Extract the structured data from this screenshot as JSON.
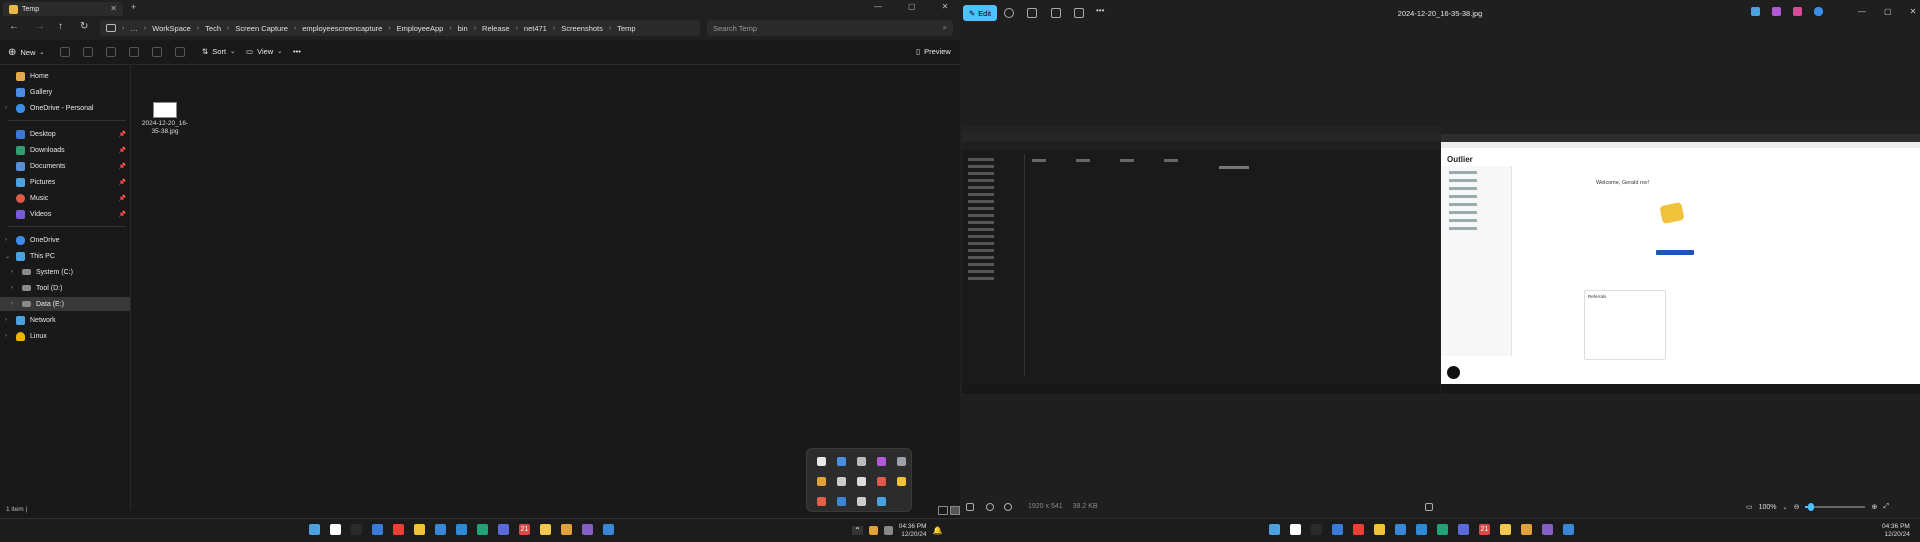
{
  "explorer": {
    "tab_title": "Temp",
    "breadcrumb": [
      "WorkSpace",
      "Tech",
      "Screen Capture",
      "employeescreencapture",
      "EmployeeApp",
      "bin",
      "Release",
      "net471",
      "Screenshots",
      "Temp"
    ],
    "search_placeholder": "Search Temp",
    "toolbar": {
      "new_label": "New",
      "sort_label": "Sort",
      "view_label": "View",
      "preview_label": "Preview"
    },
    "sidebar": {
      "quick": [
        {
          "label": "Home",
          "color": "#e3a84b"
        },
        {
          "label": "Gallery",
          "color": "#4a90e2"
        },
        {
          "label": "OneDrive - Personal",
          "color": "#3b8eea"
        }
      ],
      "pinned": [
        {
          "label": "Desktop",
          "color": "#3b78d8"
        },
        {
          "label": "Downloads",
          "color": "#2e9e6e"
        },
        {
          "label": "Documents",
          "color": "#5a8fd8"
        },
        {
          "label": "Pictures",
          "color": "#4aa3e0"
        },
        {
          "label": "Music",
          "color": "#e05a4a"
        },
        {
          "label": "Videos",
          "color": "#7a5ad8"
        }
      ],
      "tree": [
        {
          "label": "OneDrive",
          "color": "#3b8eea"
        },
        {
          "label": "This PC",
          "color": "#4aa3e0"
        },
        {
          "label": "System (C:)",
          "color": "#8a8a8a"
        },
        {
          "label": "Tool (D:)",
          "color": "#8a8a8a"
        },
        {
          "label": "Data (E:)",
          "color": "#8a8a8a"
        },
        {
          "label": "Network",
          "color": "#4aa3e0"
        },
        {
          "label": "Linux",
          "color": "#f0b400"
        }
      ]
    },
    "file_name": "2024-12-20_16-35-38.jpg",
    "status": "1 item |"
  },
  "photos": {
    "edit_label": "Edit",
    "title": "2024-12-20_16-35-38.jpg",
    "info_dims": "1920 x 541",
    "info_size": "38.2 KB",
    "zoom": "100%",
    "zoom_fraction": 0.1,
    "shot": {
      "app_title": "Outlier",
      "welcome": "Welcome, Gerald rov!",
      "panel_title": "Referrals"
    }
  },
  "taskbar": {
    "time": "04:36 PM",
    "date": "12/20/24",
    "calendar_day": "21",
    "apps": [
      {
        "name": "start",
        "color": "#4aa3e0"
      },
      {
        "name": "search",
        "color": "#ffffff"
      },
      {
        "name": "terminal",
        "color": "#2a2a2a"
      },
      {
        "name": "copilot",
        "color": "#3a7bd5"
      },
      {
        "name": "chrome",
        "color": "#e94235"
      },
      {
        "name": "explorer",
        "color": "#f0c23a"
      },
      {
        "name": "mail",
        "color": "#3a88d5"
      },
      {
        "name": "vscode",
        "color": "#2e8bd8"
      },
      {
        "name": "vscode-insiders",
        "color": "#24a37a"
      },
      {
        "name": "teams",
        "color": "#5b6ad8"
      },
      {
        "name": "calendar",
        "color": "#d84a4a"
      },
      {
        "name": "notes",
        "color": "#f2c94c"
      },
      {
        "name": "chrome-canary",
        "color": "#e2a23a"
      },
      {
        "name": "visualstudio",
        "color": "#865fc5"
      },
      {
        "name": "remote",
        "color": "#3a88d5"
      }
    ]
  },
  "tray_icons": [
    {
      "name": "tray-app-1",
      "color": "#e8e8e8"
    },
    {
      "name": "tray-app-2",
      "color": "#4a90e2"
    },
    {
      "name": "tray-app-3",
      "color": "#bbbbbb"
    },
    {
      "name": "tray-app-4",
      "color": "#b05ad8"
    },
    {
      "name": "tray-app-5",
      "color": "#9aa0a6"
    },
    {
      "name": "tray-app-6",
      "color": "#e2a23a"
    },
    {
      "name": "tray-app-7",
      "color": "#cccccc"
    },
    {
      "name": "tray-app-8",
      "color": "#dddddd"
    },
    {
      "name": "tray-app-9",
      "color": "#e05a4a"
    },
    {
      "name": "tray-app-10",
      "color": "#f0c23a"
    },
    {
      "name": "tray-app-11",
      "color": "#e0604a"
    },
    {
      "name": "tray-app-12",
      "color": "#3a88d5"
    },
    {
      "name": "tray-app-13",
      "color": "#cccccc"
    },
    {
      "name": "tray-app-14",
      "color": "#4aa3e0"
    }
  ]
}
